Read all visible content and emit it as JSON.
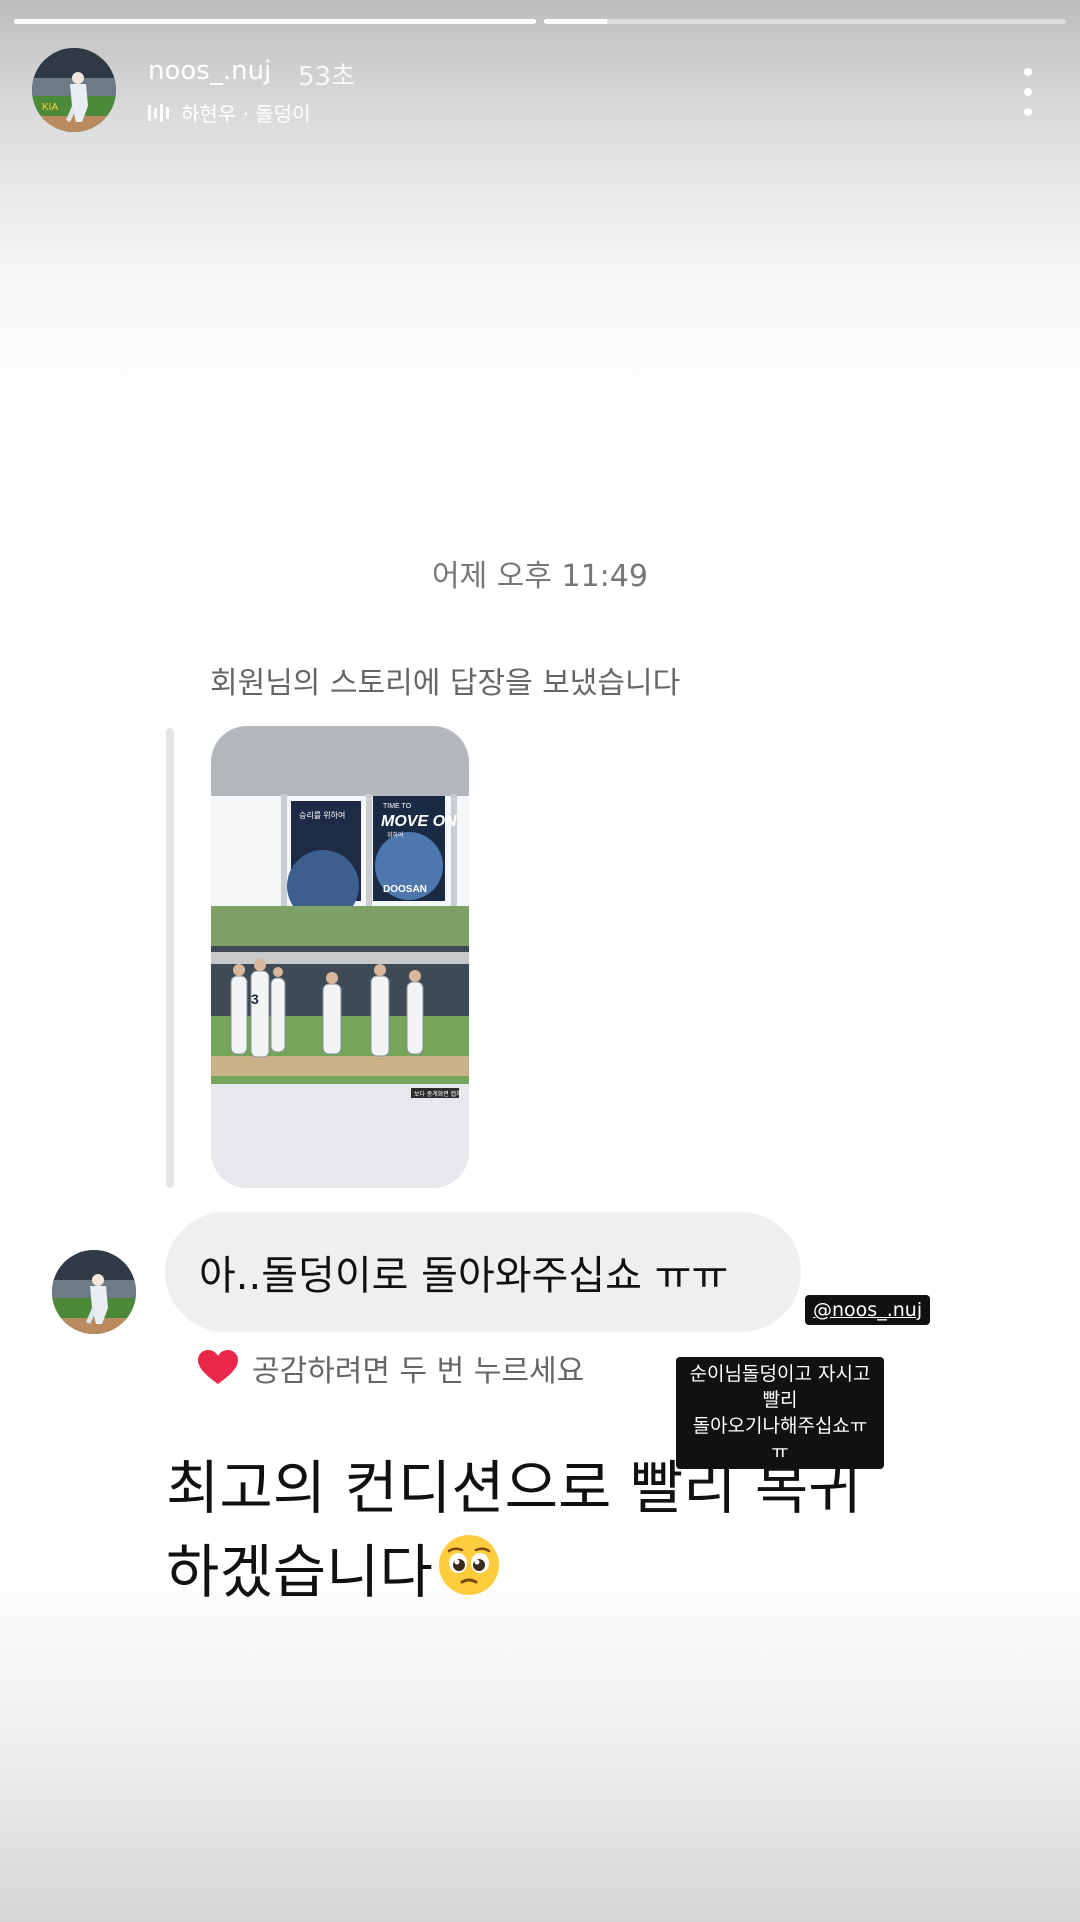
{
  "progress": {
    "segments": [
      1.0,
      0.12
    ]
  },
  "header": {
    "username": "noos_.nuj",
    "time": "53초",
    "music": "하현우 · 돌덩이"
  },
  "dm": {
    "timestamp": "어제 오후 11:49",
    "reply_note": "회원님의 스토리에 답장을 보냈습니다",
    "message": "아..돌덩이로 돌아와주십쇼 ㅠㅠ",
    "like_hint": "공감하려면 두 번 누르세요"
  },
  "story_thumb": {
    "scoreboard_left": "승리를 위하여",
    "scoreboard_right_top": "TIME TO",
    "scoreboard_right_main": "MOVE ON",
    "scoreboard_right_sub": "위하여",
    "sponsor": "DOOSAN",
    "watermark": "보다 중계화면 캡처"
  },
  "stickers": {
    "mention": "@noos_.nuj",
    "note_line1": "순이님돌덩이고 자시고빨리",
    "note_line2": "돌아오기나해주십쇼ㅠㅠ"
  },
  "caption": {
    "line1": "최고의 컨디션으로 빨리 복귀",
    "line2": "하겠습니다"
  },
  "colors": {
    "like_heart": "#e8274b",
    "bubble": "#efefef",
    "muted_text": "#666666"
  },
  "icons": {
    "more": "vertical-ellipsis",
    "music": "sound-bars",
    "like": "heart",
    "emoji": "pleading-face"
  }
}
